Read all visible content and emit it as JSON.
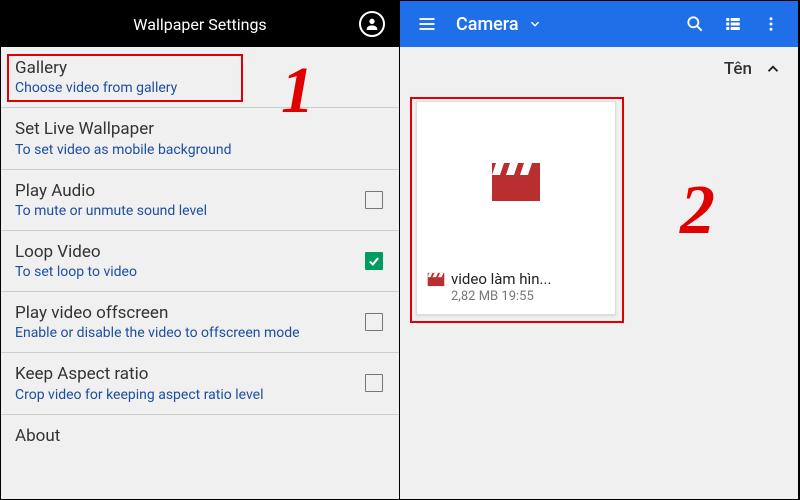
{
  "left": {
    "title": "Wallpaper Settings",
    "items": [
      {
        "title": "Gallery",
        "sub": "Choose video from gallery",
        "checkbox": null
      },
      {
        "title": "Set Live Wallpaper",
        "sub": "To set video as mobile background",
        "checkbox": null
      },
      {
        "title": "Play Audio",
        "sub": "To mute or unmute sound level",
        "checkbox": false
      },
      {
        "title": "Loop Video",
        "sub": "To set loop to video",
        "checkbox": true
      },
      {
        "title": "Play video offscreen",
        "sub": "Enable or disable the video to offscreen mode",
        "checkbox": false
      },
      {
        "title": "Keep Aspect ratio",
        "sub": "Crop video for keeping aspect ratio level",
        "checkbox": false
      },
      {
        "title": "About",
        "sub": "",
        "checkbox": null
      }
    ]
  },
  "right": {
    "title": "Camera",
    "sort_label": "Tên",
    "file": {
      "name": "video làm hìn...",
      "size": "2,82 MB",
      "time": "19:55"
    }
  },
  "annotations": {
    "step1": "1",
    "step2": "2"
  }
}
